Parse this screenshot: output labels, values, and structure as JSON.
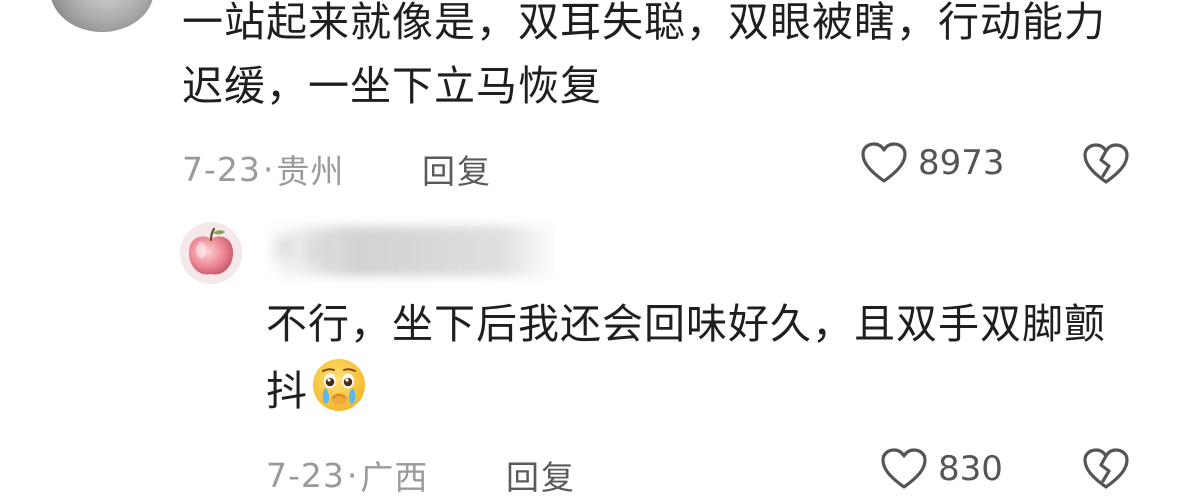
{
  "comments": [
    {
      "text": "一站起来就像是，双耳失聪，双眼被瞎，行动能力迟缓，一坐下立马恢复",
      "date": "7-23",
      "location": "贵州",
      "reply_label": "回复",
      "likes": "8973"
    },
    {
      "username": "不可",
      "text": "不行，坐下后我还会回味好久，且双手双脚颤抖",
      "emoji": "crying-face-emoji",
      "date": "7-23",
      "location": "广西",
      "reply_label": "回复",
      "likes": "830"
    }
  ],
  "separator": "·",
  "icons": {
    "like": "heart-outline-icon",
    "dislike": "broken-heart-icon"
  },
  "colors": {
    "text": "#1f1f1f",
    "meta": "#9a9a9a",
    "icon": "#555555"
  }
}
